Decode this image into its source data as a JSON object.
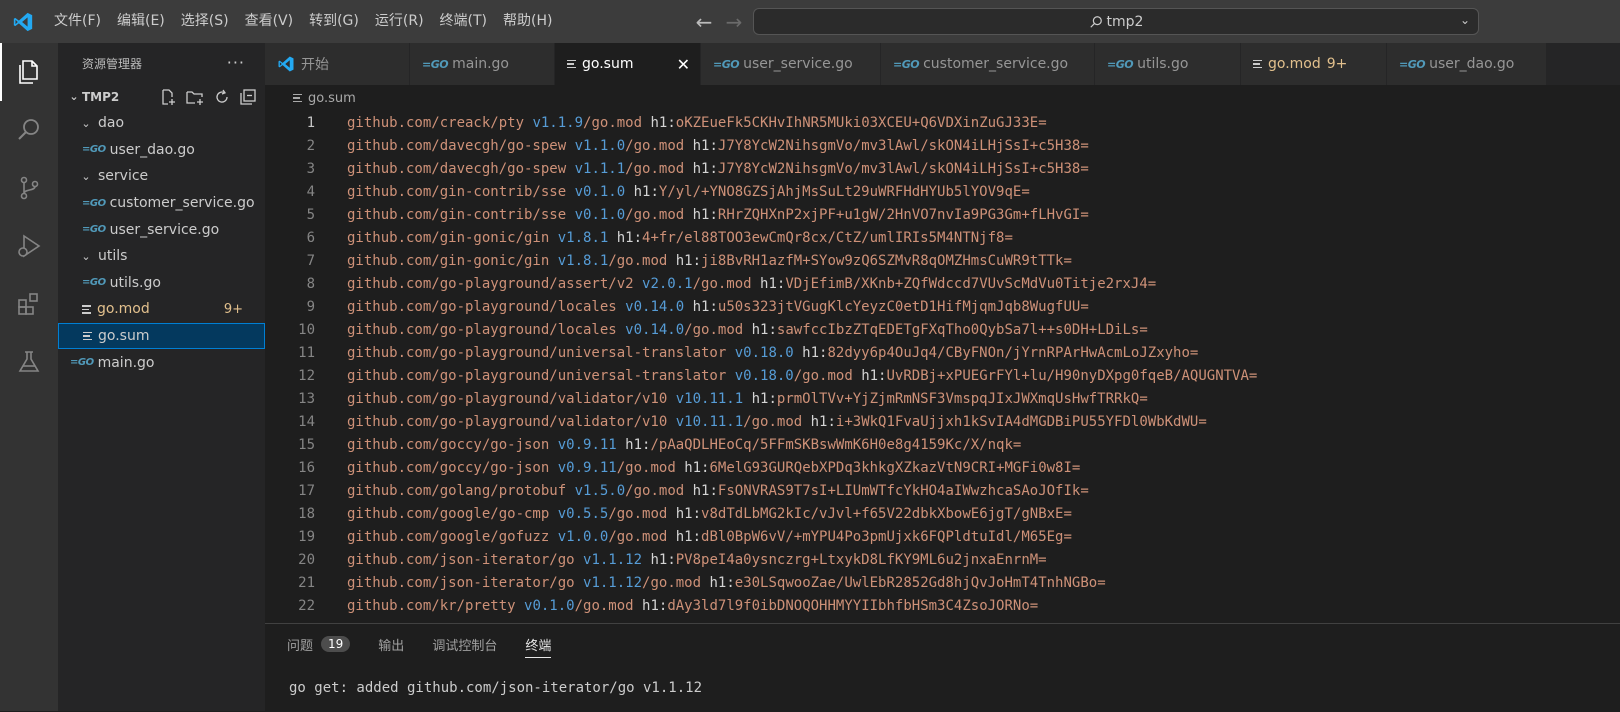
{
  "titlebar": {
    "menu": [
      "文件(F)",
      "编辑(E)",
      "选择(S)",
      "查看(V)",
      "转到(G)",
      "运行(R)",
      "终端(T)",
      "帮助(H)"
    ],
    "search_text": "tmp2",
    "colors": {
      "logo": "#23a9f2"
    }
  },
  "activitybar": {
    "items": [
      "explorer-icon",
      "search-icon",
      "source-control-icon",
      "run-debug-icon",
      "extensions-icon",
      "testing-icon"
    ]
  },
  "sidebar": {
    "title": "资源管理器",
    "more": "···",
    "root": "TMP2",
    "tree": [
      {
        "label": "dao",
        "type": "folder"
      },
      {
        "label": "user_dao.go",
        "type": "go"
      },
      {
        "label": "service",
        "type": "folder"
      },
      {
        "label": "customer_service.go",
        "type": "go"
      },
      {
        "label": "user_service.go",
        "type": "go"
      },
      {
        "label": "utils",
        "type": "folder"
      },
      {
        "label": "utils.go",
        "type": "go"
      },
      {
        "label": "go.mod",
        "type": "mod",
        "badge": "9+"
      },
      {
        "label": "go.sum",
        "type": "sum"
      },
      {
        "label": "main.go",
        "type": "go"
      }
    ]
  },
  "tabs": [
    {
      "label": "开始",
      "icon": "vscode"
    },
    {
      "label": "main.go",
      "icon": "go"
    },
    {
      "label": "go.sum",
      "icon": "lines",
      "active": true
    },
    {
      "label": "user_service.go",
      "icon": "go"
    },
    {
      "label": "customer_service.go",
      "icon": "go"
    },
    {
      "label": "utils.go",
      "icon": "go"
    },
    {
      "label": "go.mod",
      "icon": "lines",
      "badge": "9+"
    },
    {
      "label": "user_dao.go",
      "icon": "go"
    }
  ],
  "breadcrumb": "go.sum",
  "editor": {
    "lines": [
      {
        "mod": "github.com/creack/pty",
        "ver": "v1.1.9",
        "suffix": "/go.mod",
        "hash": "oKZEueFk5CKHvIhNR5MUki03XCEU+Q6VDXinZuGJ33E="
      },
      {
        "mod": "github.com/davecgh/go-spew",
        "ver": "v1.1.0",
        "suffix": "/go.mod",
        "hash": "J7Y8YcW2NihsgmVo/mv3lAwl/skON4iLHjSsI+c5H38="
      },
      {
        "mod": "github.com/davecgh/go-spew",
        "ver": "v1.1.1",
        "suffix": "/go.mod",
        "hash": "J7Y8YcW2NihsgmVo/mv3lAwl/skON4iLHjSsI+c5H38="
      },
      {
        "mod": "github.com/gin-contrib/sse",
        "ver": "v0.1.0",
        "suffix": "",
        "hash": "Y/yl/+YNO8GZSjAhjMsSuLt29uWRFHdHYUb5lYOV9qE="
      },
      {
        "mod": "github.com/gin-contrib/sse",
        "ver": "v0.1.0",
        "suffix": "/go.mod",
        "hash": "RHrZQHXnP2xjPF+u1gW/2HnVO7nvIa9PG3Gm+fLHvGI="
      },
      {
        "mod": "github.com/gin-gonic/gin",
        "ver": "v1.8.1",
        "suffix": "",
        "hash": "4+fr/el88TOO3ewCmQr8cx/CtZ/umlIRIs5M4NTNjf8="
      },
      {
        "mod": "github.com/gin-gonic/gin",
        "ver": "v1.8.1",
        "suffix": "/go.mod",
        "hash": "ji8BvRH1azfM+SYow9zQ6SZMvR8qOMZHmsCuWR9tTTk="
      },
      {
        "mod": "github.com/go-playground/assert/v2",
        "ver": "v2.0.1",
        "suffix": "/go.mod",
        "hash": "VDjEfimB/XKnb+ZQfWdccd7VUvScMdVu0Titje2rxJ4="
      },
      {
        "mod": "github.com/go-playground/locales",
        "ver": "v0.14.0",
        "suffix": "",
        "hash": "u50s323jtVGugKlcYeyzC0etD1HifMjqmJqb8WugfUU="
      },
      {
        "mod": "github.com/go-playground/locales",
        "ver": "v0.14.0",
        "suffix": "/go.mod",
        "hash": "sawfccIbzZTqEDETgFXqTho0QybSa7l++s0DH+LDiLs="
      },
      {
        "mod": "github.com/go-playground/universal-translator",
        "ver": "v0.18.0",
        "suffix": "",
        "hash": "82dyy6p4OuJq4/CByFNOn/jYrnRPArHwAcmLoJZxyho="
      },
      {
        "mod": "github.com/go-playground/universal-translator",
        "ver": "v0.18.0",
        "suffix": "/go.mod",
        "hash": "UvRDBj+xPUEGrFYl+lu/H90nyDXpg0fqeB/AQUGNTVA="
      },
      {
        "mod": "github.com/go-playground/validator/v10",
        "ver": "v10.11.1",
        "suffix": "",
        "hash": "prmOlTVv+YjZjmRmNSF3VmspqJIxJWXmqUsHwfTRRkQ="
      },
      {
        "mod": "github.com/go-playground/validator/v10",
        "ver": "v10.11.1",
        "suffix": "/go.mod",
        "hash": "i+3WkQ1FvaUjjxh1kSvIA4dMGDBiPU55YFDl0WbKdWU="
      },
      {
        "mod": "github.com/goccy/go-json",
        "ver": "v0.9.11",
        "suffix": "",
        "hash": "/pAaQDLHEoCq/5FFmSKBswWmK6H0e8g4159Kc/X/nqk="
      },
      {
        "mod": "github.com/goccy/go-json",
        "ver": "v0.9.11",
        "suffix": "/go.mod",
        "hash": "6MelG93GURQebXPDq3khkgXZkazVtN9CRI+MGFi0w8I="
      },
      {
        "mod": "github.com/golang/protobuf",
        "ver": "v1.5.0",
        "suffix": "/go.mod",
        "hash": "FsONVRAS9T7sI+LIUmWTfcYkHO4aIWwzhcaSAoJOfIk="
      },
      {
        "mod": "github.com/google/go-cmp",
        "ver": "v0.5.5",
        "suffix": "/go.mod",
        "hash": "v8dTdLbMG2kIc/vJvl+f65V22dbkXbowE6jgT/gNBxE="
      },
      {
        "mod": "github.com/google/gofuzz",
        "ver": "v1.0.0",
        "suffix": "/go.mod",
        "hash": "dBl0BpW6vV/+mYPU4Po3pmUjxk6FQPldtuIdl/M65Eg="
      },
      {
        "mod": "github.com/json-iterator/go",
        "ver": "v1.1.12",
        "suffix": "",
        "hash": "PV8peI4a0ysnczrg+LtxykD8LfKY9ML6u2jnxaEnrnM="
      },
      {
        "mod": "github.com/json-iterator/go",
        "ver": "v1.1.12",
        "suffix": "/go.mod",
        "hash": "e30LSqwooZae/UwlEbR2852Gd8hjQvJoHmT4TnhNGBo="
      },
      {
        "mod": "github.com/kr/pretty",
        "ver": "v0.1.0",
        "suffix": "/go.mod",
        "hash": "dAy3ld7l9f0ibDNOQOHHMYYIIbhfbHSm3C4ZsoJORNo="
      }
    ]
  },
  "panel": {
    "tabs": [
      {
        "label": "问题",
        "count": "19"
      },
      {
        "label": "输出"
      },
      {
        "label": "调试控制台"
      },
      {
        "label": "终端",
        "active": true
      }
    ],
    "terminal_text": "go get: added github.com/json-iterator/go v1.1.12"
  }
}
